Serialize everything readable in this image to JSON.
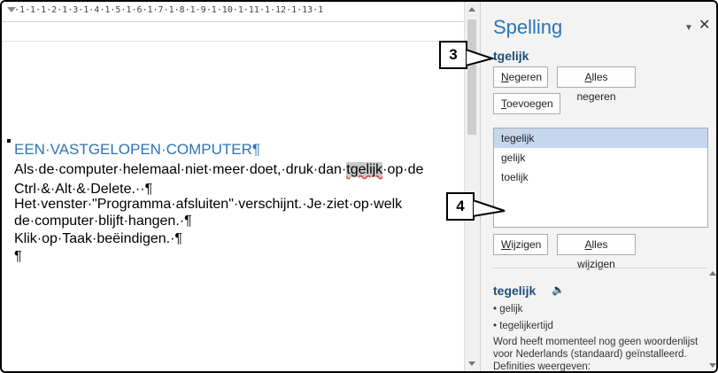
{
  "ruler": {
    "numbers": "·1·1·1·2·1·3·1·4·1·5·1·6·1·7·1·8·1·9·1·10·1·11·1·12·1·13·1"
  },
  "document": {
    "heading": "EEN·VASTGELOPEN·COMPUTER¶",
    "line1_before": "Als·de·computer·helemaal·niet·meer·doet,·druk·dan·",
    "line1_word": "tgelijk",
    "line1_after": "·op·de",
    "line2": "Ctrl·&·Alt·&·Delete.··¶",
    "line3": "Het·venster·\"Programma·afsluiten\"·verschijnt.·Je·ziet·op·welk",
    "line4": "de·computer·blijft·hangen.·¶",
    "line5": "Klik·op·Taak·beëindigen.·¶",
    "line6": "¶"
  },
  "pane": {
    "title": "Spelling",
    "menu_glyph": "▼",
    "close_glyph": "✕",
    "misspelled_word": "tgelijk",
    "buttons": {
      "ignore_u": "N",
      "ignore_rest": "egeren",
      "ignore_all_u": "A",
      "ignore_all_rest": "lles negeren",
      "add_u": "T",
      "add_rest": "oevoegen",
      "change_u": "W",
      "change_rest": "ijzigen",
      "change_all_u": "A",
      "change_all_rest": "lles wijzigen"
    },
    "suggestions": [
      "tegelijk",
      "gelijk",
      "toelijk"
    ],
    "definition": {
      "word": "tegelijk",
      "items": [
        "• gelijk",
        "• tegelijkertijd"
      ],
      "note": "Word heeft momenteel nog geen woordenlijst voor Nederlands (standaard) geïnstalleerd. Definities weergeven:"
    }
  },
  "callouts": {
    "three": "3",
    "four": "4"
  },
  "icons": {
    "speaker": "speaker-icon",
    "close": "close-icon",
    "menu": "dropdown-icon"
  }
}
